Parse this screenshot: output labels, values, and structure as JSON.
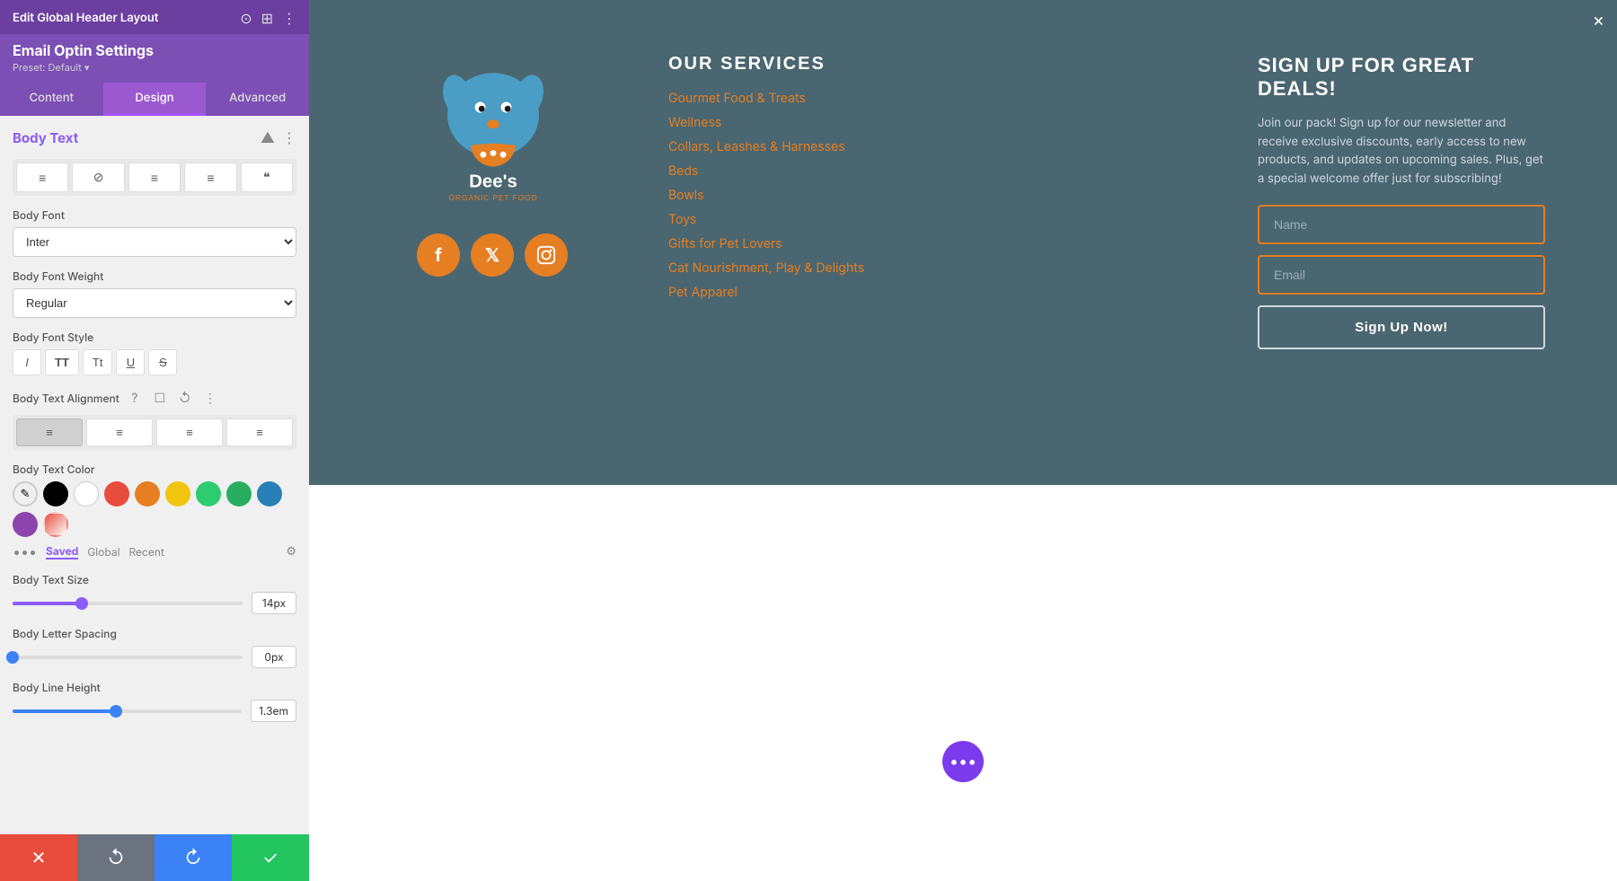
{
  "panel": {
    "header": {
      "title": "Edit Global Header Layout",
      "close_label": "×"
    },
    "subheader": {
      "title": "Email Optin Settings",
      "preset_label": "Preset: Default ▾"
    },
    "tabs": [
      {
        "id": "content",
        "label": "Content"
      },
      {
        "id": "design",
        "label": "Design"
      },
      {
        "id": "advanced",
        "label": "Advanced"
      }
    ],
    "active_tab": "design",
    "section": {
      "title": "Body Text",
      "collapse_icon": "▲",
      "more_icon": "⋮"
    },
    "text_align_buttons": [
      {
        "icon": "≡",
        "id": "align-left"
      },
      {
        "icon": "⊘",
        "id": "none"
      },
      {
        "icon": "≡",
        "id": "align-center"
      },
      {
        "icon": "≡",
        "id": "align-right"
      },
      {
        "icon": "❝",
        "id": "quote"
      }
    ],
    "body_font": {
      "label": "Body Font",
      "value": "Inter"
    },
    "body_font_weight": {
      "label": "Body Font Weight",
      "value": "Regular"
    },
    "body_font_style": {
      "label": "Body Font Style",
      "buttons": [
        {
          "label": "I",
          "id": "italic"
        },
        {
          "label": "TT",
          "id": "all-caps"
        },
        {
          "label": "Tt",
          "id": "capitalize"
        },
        {
          "label": "U",
          "id": "underline"
        },
        {
          "label": "S̶",
          "id": "strikethrough"
        }
      ]
    },
    "body_text_alignment": {
      "label": "Body Text Alignment",
      "help": "?",
      "icons": [
        "☐",
        "↺",
        "⋮"
      ],
      "buttons": [
        {
          "icon": "≡",
          "id": "left",
          "active": true
        },
        {
          "icon": "≡",
          "id": "center"
        },
        {
          "icon": "≡",
          "id": "right"
        },
        {
          "icon": "≡",
          "id": "justify"
        }
      ]
    },
    "body_text_color": {
      "label": "Body Text Color",
      "swatches": [
        {
          "color": "eyedropper",
          "id": "eyedropper"
        },
        {
          "color": "#000000",
          "id": "black"
        },
        {
          "color": "#ffffff",
          "id": "white"
        },
        {
          "color": "#e74c3c",
          "id": "red"
        },
        {
          "color": "#e67e22",
          "id": "orange"
        },
        {
          "color": "#f1c40f",
          "id": "yellow"
        },
        {
          "color": "#2ecc71",
          "id": "green"
        },
        {
          "color": "#27ae60",
          "id": "dark-green"
        },
        {
          "color": "#2980b9",
          "id": "blue"
        },
        {
          "color": "#8e44ad",
          "id": "purple"
        },
        {
          "color": "#e74c3c",
          "id": "red-2",
          "style": "pencil"
        }
      ],
      "color_tabs": [
        {
          "label": "Saved",
          "active": true
        },
        {
          "label": "Global"
        },
        {
          "label": "Recent"
        }
      ]
    },
    "body_text_size": {
      "label": "Body Text Size",
      "value": "14px",
      "percent": 30
    },
    "body_letter_spacing": {
      "label": "Body Letter Spacing",
      "value": "0px",
      "percent": 0
    },
    "body_line_height": {
      "label": "Body Line Height",
      "value": "1.3em",
      "percent": 45
    },
    "bottom_toolbar": {
      "cancel_icon": "✕",
      "undo_icon": "↺",
      "redo_icon": "↻",
      "save_icon": "✓"
    }
  },
  "content": {
    "close_icon": "×",
    "brand": {
      "logo_alt": "Dee's Organic Pet Food"
    },
    "services": {
      "title": "OUR SERVICES",
      "links": [
        "Gourmet Food & Treats",
        "Wellness",
        "Collars, Leashes & Harnesses",
        "Beds",
        "Bowls",
        "Toys",
        "Gifts for Pet Lovers",
        "Cat Nourishment, Play & Delights",
        "Pet Apparel"
      ]
    },
    "signup": {
      "title": "SIGN UP FOR GREAT DEALS!",
      "description": "Join our pack! Sign up for our newsletter and receive exclusive discounts, early access to new products, and updates on upcoming sales. Plus, get a special welcome offer just for subscribing!",
      "name_placeholder": "Name",
      "email_placeholder": "Email",
      "button_label": "Sign Up Now!"
    },
    "floating_dots": "•••"
  }
}
